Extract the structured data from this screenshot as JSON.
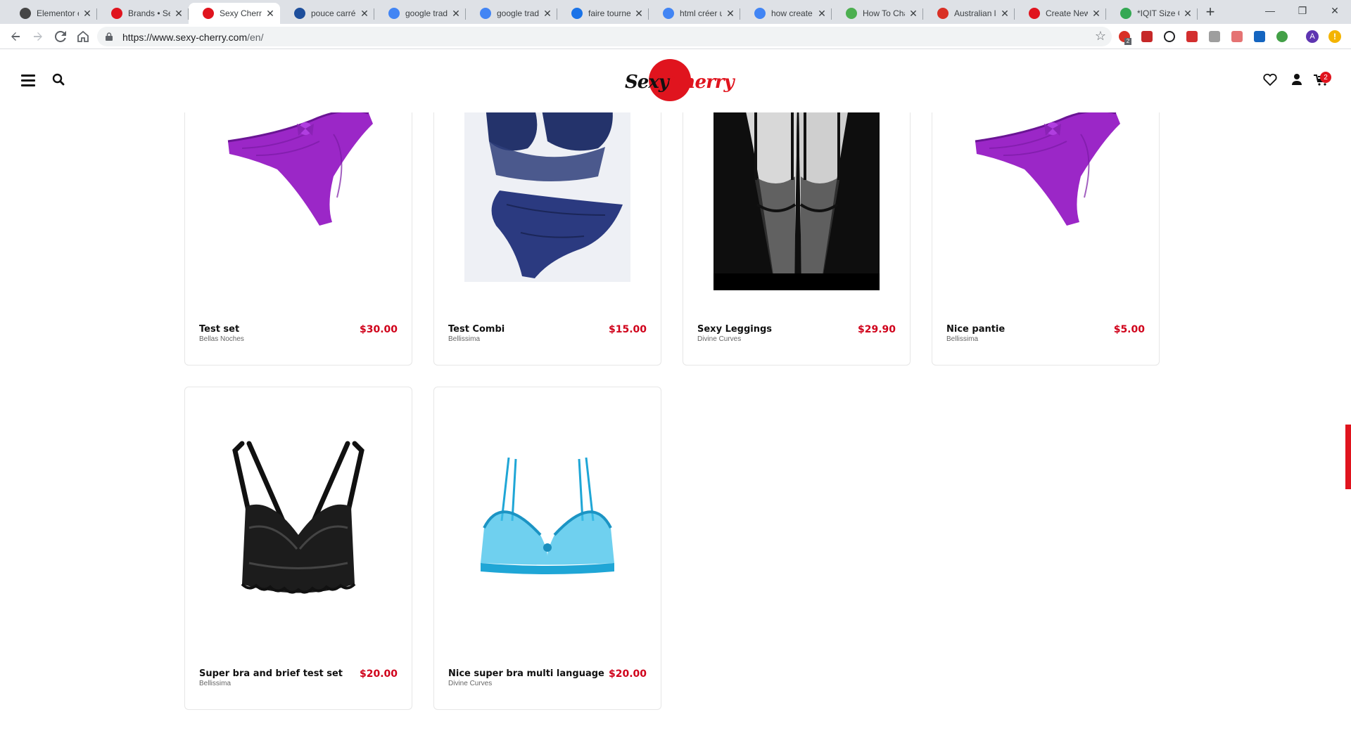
{
  "browser": {
    "tabs": [
      {
        "label": "Elementor e",
        "icon": "wordpress-icon",
        "color": "#464646"
      },
      {
        "label": "Brands • Sex",
        "icon": "sexy-cherry-favicon",
        "color": "#e0141e"
      },
      {
        "label": "Sexy Cherry",
        "icon": "sexy-cherry-favicon",
        "color": "#e0141e"
      },
      {
        "label": "pouce carré",
        "icon": "dictionary-icon",
        "color": "#1e4f9c"
      },
      {
        "label": "google tradu",
        "icon": "google-icon",
        "color": "#4285f4"
      },
      {
        "label": "google tradu",
        "icon": "google-icon",
        "color": "#4285f4"
      },
      {
        "label": "faire tourner",
        "icon": "site-icon",
        "color": "#1a73e8"
      },
      {
        "label": "html créer u",
        "icon": "google-icon",
        "color": "#4285f4"
      },
      {
        "label": "how create s",
        "icon": "google-icon",
        "color": "#4285f4"
      },
      {
        "label": "How To Cha",
        "icon": "w3schools-icon",
        "color": "#4caf50"
      },
      {
        "label": "Australian la",
        "icon": "gmail-icon",
        "color": "#d93025"
      },
      {
        "label": "Create New",
        "icon": "sexy-cherry-favicon",
        "color": "#e0141e"
      },
      {
        "label": "*IQIT Size C",
        "icon": "edit-icon",
        "color": "#34a853"
      }
    ],
    "active_tab": 2,
    "url_host": "https://www.sexy-cherry.com",
    "url_path": "/en/",
    "new_tab_label": "+",
    "avatar_letter": "A",
    "update_label": "!",
    "extension_badge": "2"
  },
  "header": {
    "logo_part1": "Sexy",
    "logo_part2": "Cherry",
    "cart_count": "2"
  },
  "products": [
    {
      "name": "Test set",
      "brand": "Bellas Noches",
      "price": "$30.00",
      "image": "purple-lace-thong"
    },
    {
      "name": "Test Combi",
      "brand": "Bellissima",
      "price": "$15.00",
      "image": "navy-lace-bra-set"
    },
    {
      "name": "Sexy Leggings",
      "brand": "Divine Curves",
      "price": "$29.90",
      "image": "black-stockings-garter"
    },
    {
      "name": "Nice pantie",
      "brand": "Bellissima",
      "price": "$5.00",
      "image": "purple-lace-thong"
    },
    {
      "name": "Super bra and brief test set",
      "brand": "Bellissima",
      "price": "$20.00",
      "image": "black-lace-bralette"
    },
    {
      "name": "Nice super bra multi language",
      "brand": "Divine Curves",
      "price": "$20.00",
      "image": "turquoise-lace-bra"
    }
  ],
  "colors": {
    "accent": "#e0141e",
    "price": "#d0021b"
  }
}
